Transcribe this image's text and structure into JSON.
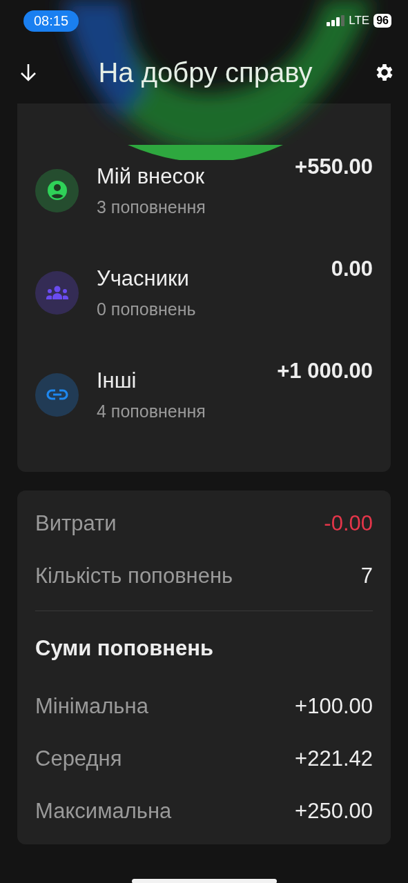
{
  "status_bar": {
    "time": "08:15",
    "network": "LTE",
    "battery": "96"
  },
  "header": {
    "title": "На добру справу"
  },
  "sources": [
    {
      "kind": "person",
      "color": "#2fd158",
      "title": "Мій внесок",
      "subtitle": "3 поповнення",
      "amount": "+550.00"
    },
    {
      "kind": "group",
      "color": "#6a4cf0",
      "title": "Учасники",
      "subtitle": "0 поповнень",
      "amount": "0.00"
    },
    {
      "kind": "link",
      "color": "#1e88f0",
      "title": "Інші",
      "subtitle": "4 поповнення",
      "amount": "+1 000.00"
    }
  ],
  "stats": [
    {
      "label": "Витрати",
      "value": "-0.00",
      "negative": true
    },
    {
      "label": "Кількість поповнень",
      "value": "7",
      "negative": false
    }
  ],
  "sums": {
    "title": "Суми поповнень",
    "rows": [
      {
        "label": "Мінімальна",
        "value": "+100.00"
      },
      {
        "label": "Середня",
        "value": "+221.42"
      },
      {
        "label": "Максимальна",
        "value": "+250.00"
      }
    ]
  }
}
